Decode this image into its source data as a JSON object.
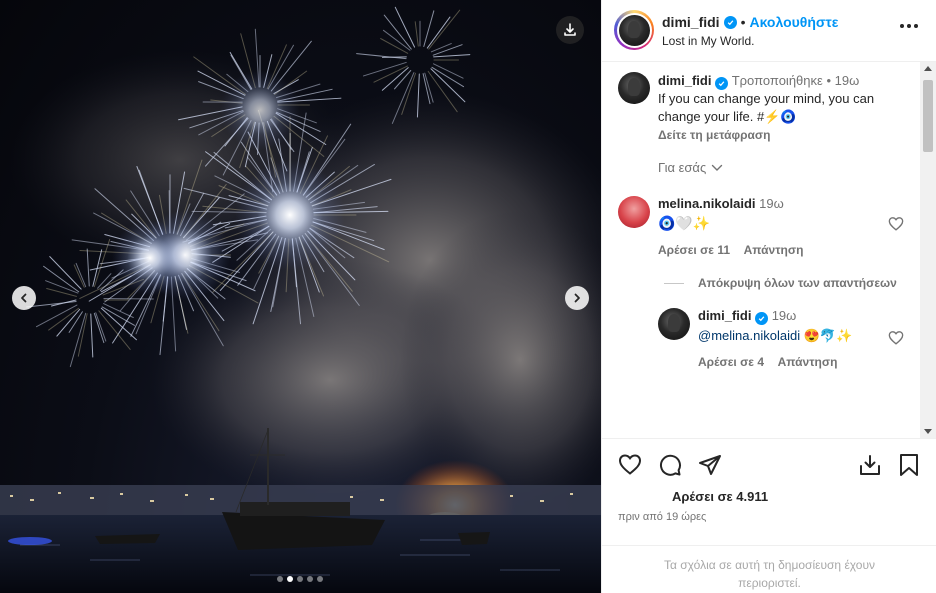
{
  "post": {
    "username": "dimi_fidi",
    "follow_label": "Ακολουθήστε",
    "separator": "•",
    "subtitle": "Lost in My World.",
    "carousel": {
      "slide_count": 5,
      "active_index": 1
    }
  },
  "caption": {
    "username": "dimi_fidi",
    "edited_label": "Τροποποιήθηκε",
    "separator": "•",
    "time": "19ω",
    "text": "If you can change your mind, you can change your life. #⚡🧿",
    "translate_label": "Δείτε τη μετάφραση",
    "for_you_label": "Για εσάς"
  },
  "comments": [
    {
      "username": "melina.nikolaidi",
      "time": "19ω",
      "text": "🧿🤍✨",
      "likes_label": "Αρέσει σε 11",
      "reply_label": "Απάντηση",
      "hide_replies_label": "Απόκρυψη όλων των απαντήσεων",
      "replies": [
        {
          "username": "dimi_fidi",
          "time": "19ω",
          "mention": "@melina.nikolaidi",
          "emoji": "😍🐬✨",
          "likes_label": "Αρέσει σε 4",
          "reply_label": "Απάντηση"
        }
      ]
    }
  ],
  "actions": {
    "likes_label": "Αρέσει σε 4.911",
    "time_ago": "πριν από 19 ώρες",
    "restricted_text": "Τα σχόλια σε αυτή τη δημοσίευση έχουν περιοριστεί."
  },
  "colors": {
    "accent": "#0095f6",
    "text": "#262626",
    "muted": "#737373",
    "link": "#00376b"
  },
  "icons": [
    "download-icon",
    "chevron-left-icon",
    "chevron-right-icon",
    "verified-icon",
    "more-icon",
    "heart-icon",
    "comment-icon",
    "share-icon",
    "save-icon",
    "chevron-down-icon"
  ]
}
